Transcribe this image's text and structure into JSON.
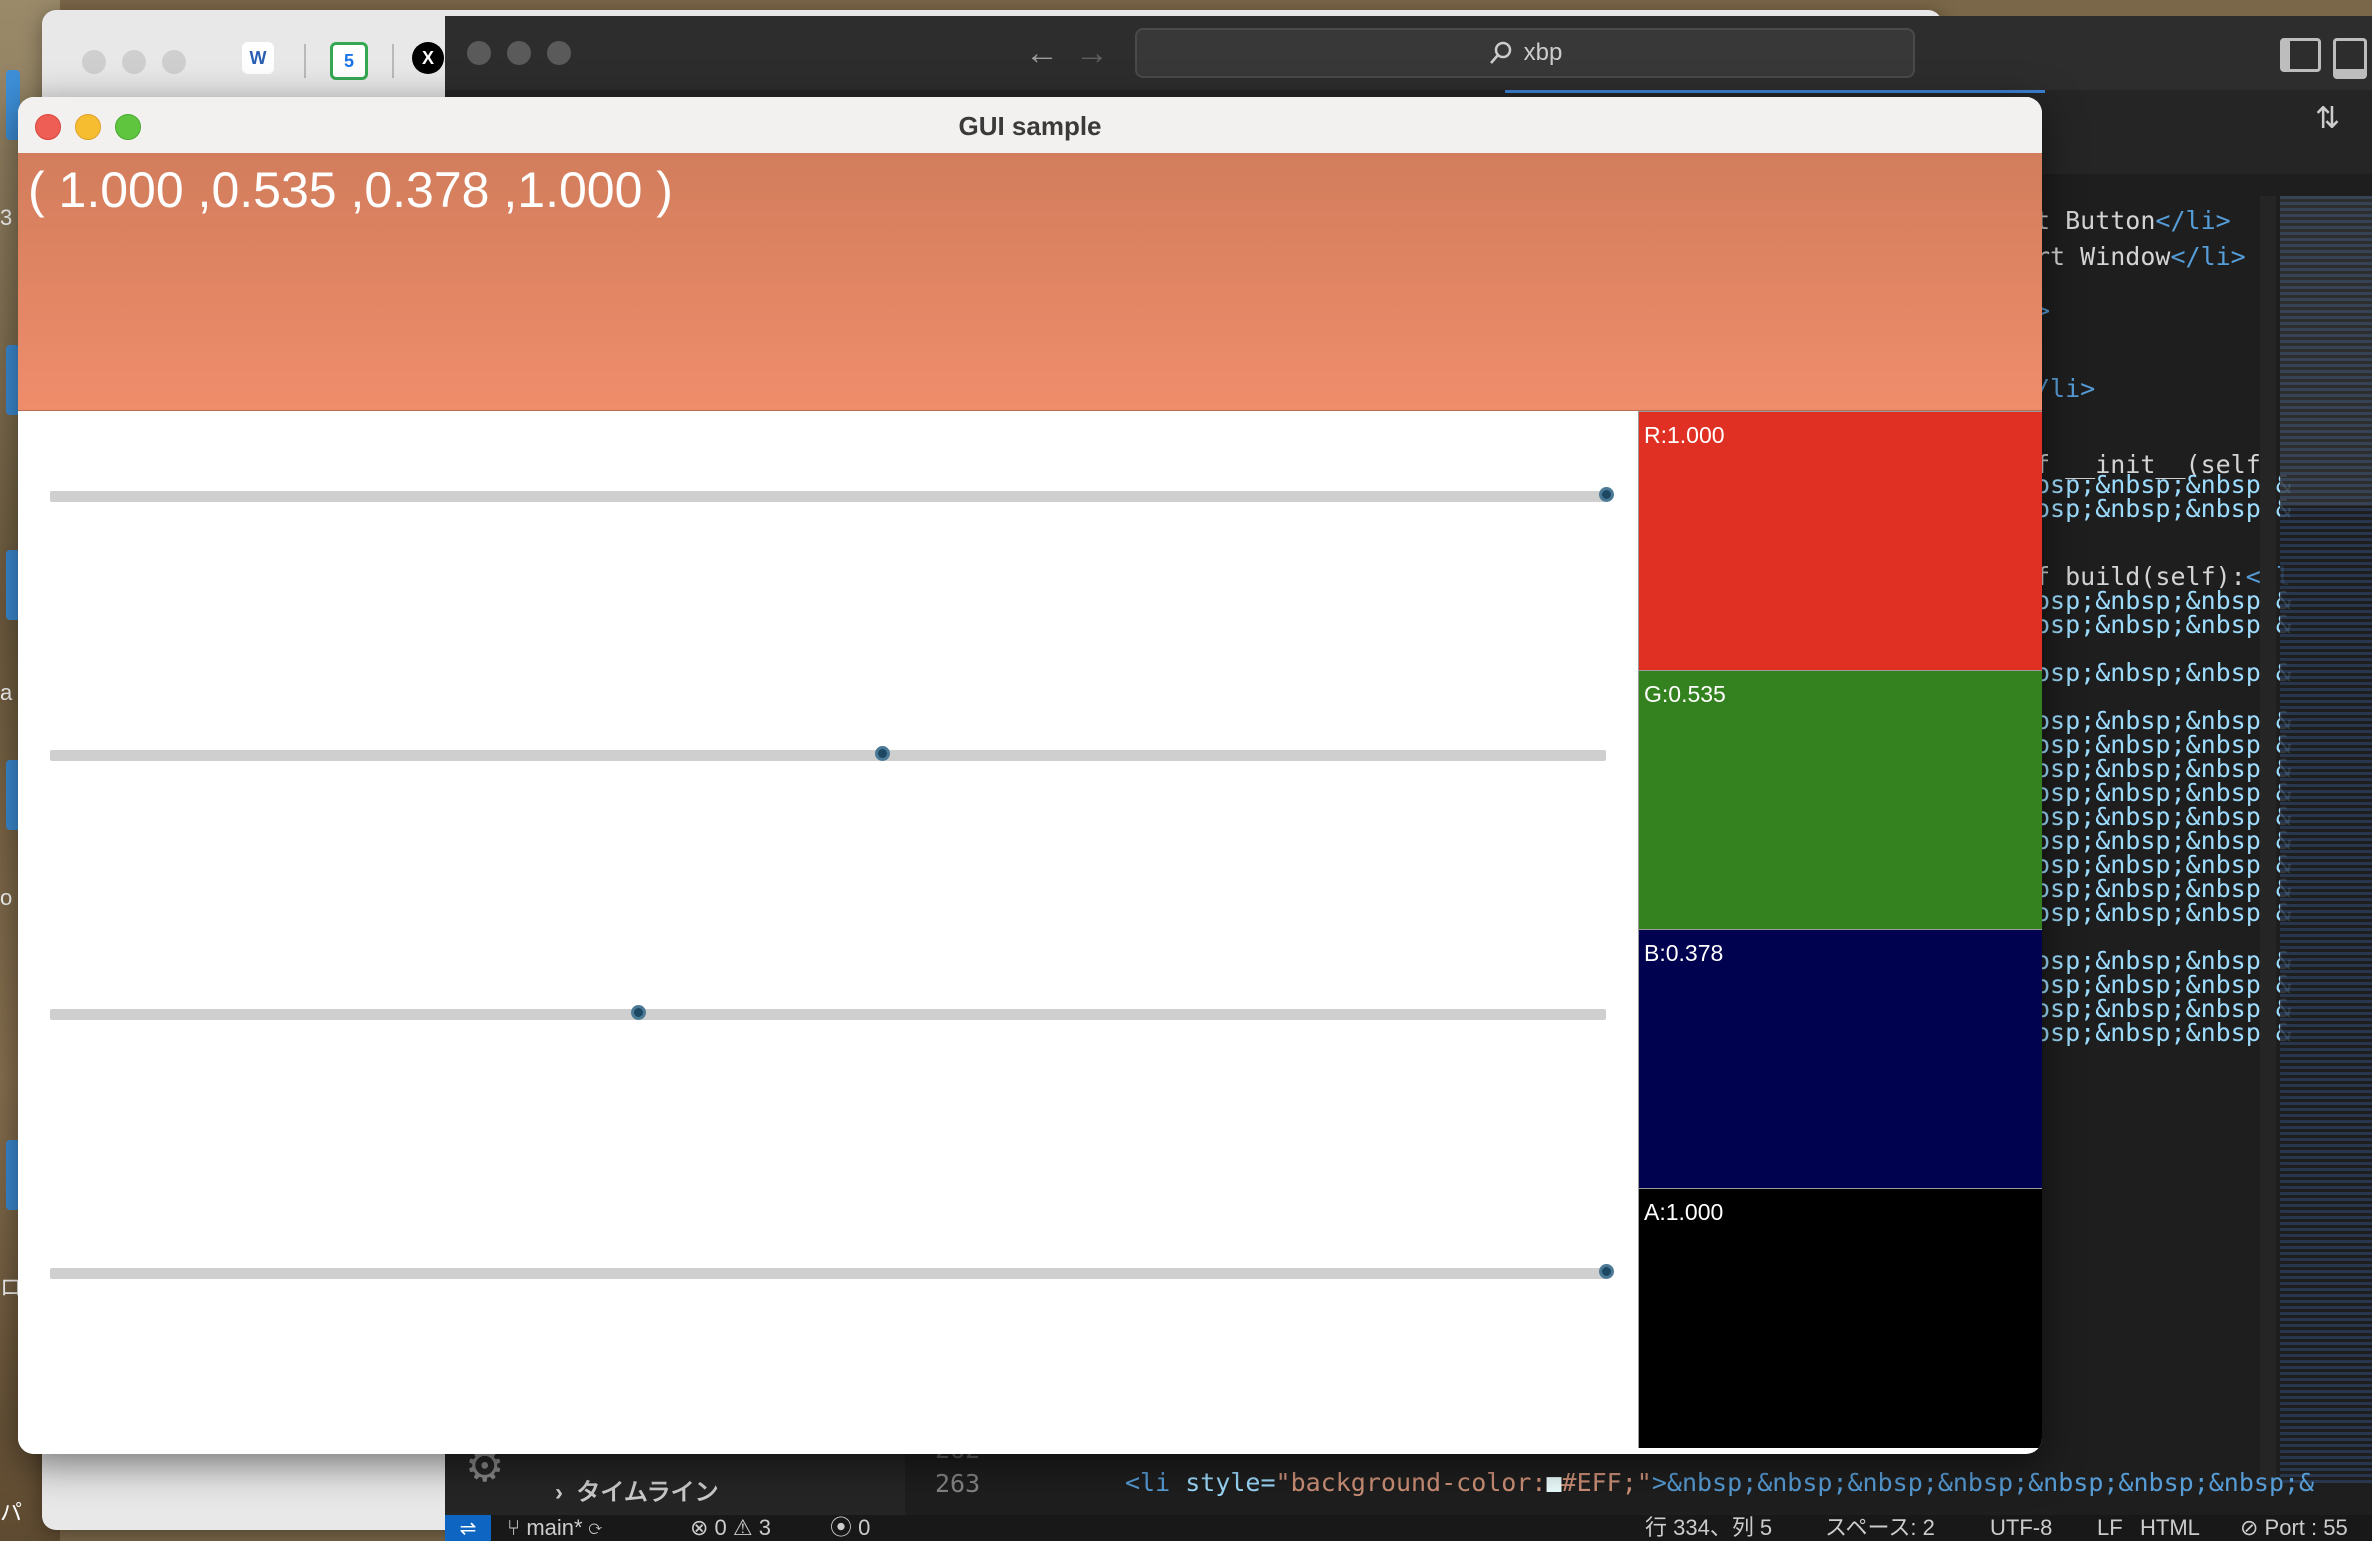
{
  "browser": {
    "tabs": [
      {
        "label": "W",
        "name": "w-favicon"
      },
      {
        "label": "5",
        "name": "calendar-favicon"
      },
      {
        "label": "X",
        "name": "x-favicon"
      }
    ]
  },
  "desktop": {
    "chars": [
      "3",
      "a",
      "o",
      "ロ",
      "パ"
    ]
  },
  "vscode": {
    "search": "xbp",
    "code_lines": [
      {
        "text": "t Button",
        "tag": "</li>"
      },
      {
        "text": "rt Window",
        "tag": "</li>"
      },
      {
        "text": "",
        "tag": ">"
      },
      {
        "text": "",
        "tag": "/li>"
      },
      {
        "text": "f __init__(self,",
        "tag": ""
      },
      {
        "text": "",
        "nbsp": "osp;&nbsp;&nbsp;&"
      },
      {
        "text": "",
        "nbsp": "osp;&nbsp;&nbsp;&"
      },
      {
        "text": "f build(self):",
        "tag": "</l"
      },
      {
        "text": "",
        "nbsp": "osp;&nbsp;&nbsp;&"
      },
      {
        "text": "",
        "nbsp": "osp;&nbsp;&nbsp;&"
      },
      {
        "text": "",
        "nbsp": "osp;&nbsp;&nbsp;&"
      },
      {
        "text": "",
        "nbsp": "osp;&nbsp;&nbsp;&"
      },
      {
        "text": "",
        "nbsp": "osp;&nbsp;&nbsp;&"
      },
      {
        "text": "",
        "nbsp": "osp;&nbsp;&nbsp;&"
      },
      {
        "text": "",
        "nbsp": "osp;&nbsp;&nbsp;&"
      },
      {
        "text": "",
        "nbsp": "osp;&nbsp;&nbsp;&"
      },
      {
        "text": "",
        "nbsp": "osp;&nbsp;&nbsp;&"
      },
      {
        "text": "",
        "nbsp": "osp;&nbsp;&nbsp;&"
      },
      {
        "text": "",
        "nbsp": "osp;&nbsp;&nbsp;&"
      },
      {
        "text": "",
        "nbsp": "osp;&nbsp;&nbsp;&"
      },
      {
        "text": "",
        "nbsp": "osp;&nbsp;&nbsp;&"
      },
      {
        "text": "",
        "nbsp": "osp;&nbsp;&nbsp;&"
      },
      {
        "text": "",
        "nbsp": "osp;&nbsp;&nbsp;&"
      },
      {
        "text": "",
        "nbsp": "osp;&nbsp;&nbsp;&"
      }
    ],
    "timeline_label": "タイムライン",
    "gutter_lines": [
      "262",
      "263"
    ],
    "bottom_code": {
      "open": "<li",
      "attr": "style=",
      "value": "\"background-color:",
      "swatch": "■",
      "value2": "#EFF;\"",
      "close": ">&nbsp;&nbsp;&nbsp;&nbsp;&nbsp;&nbsp;&nbsp;&"
    },
    "status": {
      "branch": "main*",
      "errors": "0",
      "warnings": "3",
      "ports": "0",
      "cursor": "行 334、列 5",
      "spaces": "スペース: 2",
      "encoding": "UTF-8",
      "eol": "LF",
      "language": "HTML",
      "port": "Port : 55"
    }
  },
  "gui": {
    "title": "GUI sample",
    "color_text": "( 1.000 ,0.535 ,0.378 ,1.000 )",
    "preview_color": "#e0856a",
    "sliders": [
      {
        "name": "red",
        "value": 1.0,
        "label": "R:1.000",
        "color": "#e03023"
      },
      {
        "name": "green",
        "value": 0.535,
        "label": "G:0.535",
        "color": "#34821f"
      },
      {
        "name": "blue",
        "value": 0.378,
        "label": "B:0.378",
        "color": "#01024f"
      },
      {
        "name": "alpha",
        "value": 1.0,
        "label": "A:1.000",
        "color": "#000000"
      }
    ]
  }
}
